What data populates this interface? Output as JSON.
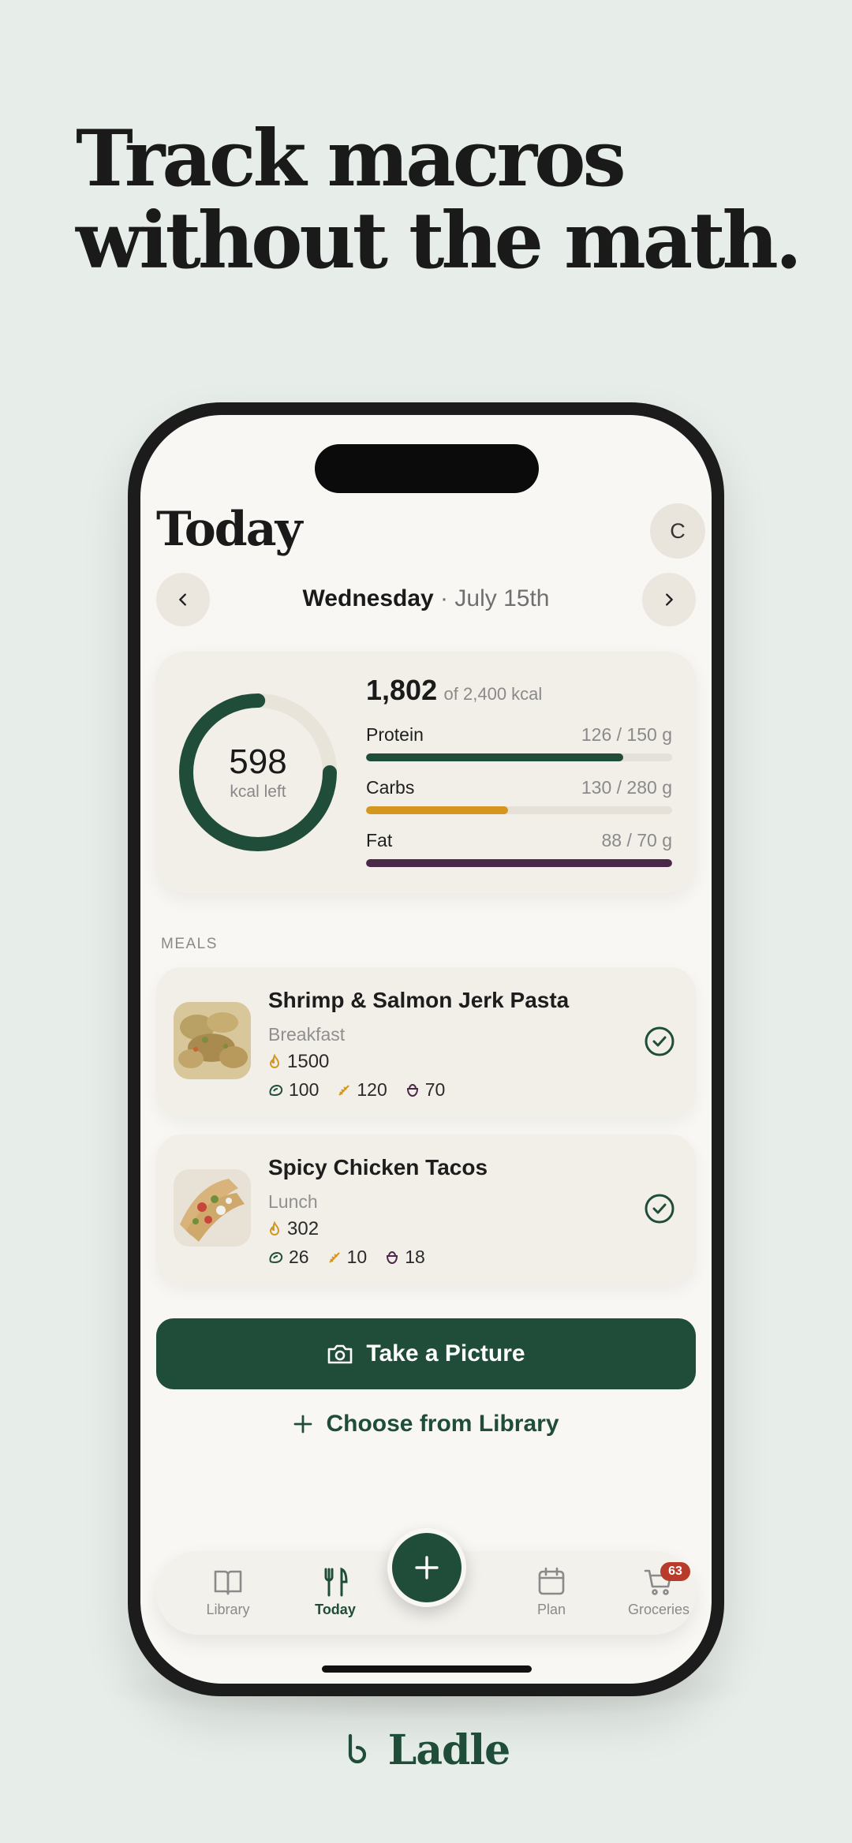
{
  "headline": {
    "line1": "Track macros",
    "line2": "without the math."
  },
  "header": {
    "title": "Today",
    "avatar_initial": "C",
    "day": "Wednesday",
    "separator": "·",
    "date": "July 15th"
  },
  "summary": {
    "kcal_left": "598",
    "kcal_left_label": "kcal left",
    "consumed": "1,802",
    "goal_text": "of 2,400 kcal",
    "ring_progress": 0.75,
    "macros": [
      {
        "name": "Protein",
        "amount": "126 / 150 g",
        "fraction": 0.84,
        "color": "#1f4d3a"
      },
      {
        "name": "Carbs",
        "amount": "130 / 280 g",
        "fraction": 0.464,
        "color": "#d4961f"
      },
      {
        "name": "Fat",
        "amount": "88 / 70 g",
        "fraction": 1.0,
        "color": "#4a2848"
      }
    ]
  },
  "meals_label": "MEALS",
  "meals": [
    {
      "name": "Shrimp & Salmon Jerk Pasta",
      "type": "Breakfast",
      "kcal": "1500",
      "protein": "100",
      "carbs": "120",
      "fat": "70"
    },
    {
      "name": "Spicy Chicken Tacos",
      "type": "Lunch",
      "kcal": "302",
      "protein": "26",
      "carbs": "10",
      "fat": "18"
    }
  ],
  "actions": {
    "take_picture": "Take a Picture",
    "choose_library": "Choose from Library"
  },
  "tabbar": {
    "library": "Library",
    "today": "Today",
    "plan": "Plan",
    "groceries": "Groceries",
    "groceries_badge": "63"
  },
  "brand": {
    "name": "Ladle"
  },
  "colors": {
    "accent": "#1f4d3a",
    "carbs": "#d4961f",
    "fat": "#4a2848",
    "badge": "#b73a2a"
  }
}
